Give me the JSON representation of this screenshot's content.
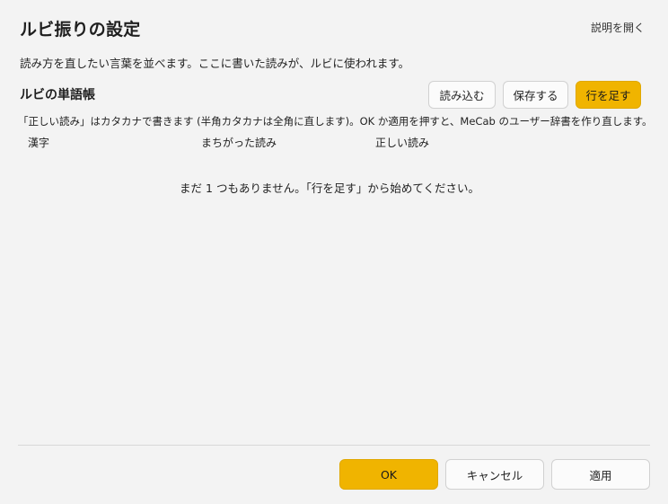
{
  "dialog": {
    "title": "ルビ振りの設定",
    "help_link": "説明を開く",
    "description": "読み方を直したい言葉を並べます。ここに書いた読みが、ルビに使われます。"
  },
  "dictionary": {
    "section_title": "ルビの単語帳",
    "load_label": "読み込む",
    "save_label": "保存する",
    "add_row_label": "行を足す",
    "note": "「正しい読み」はカタカナで書きます (半角カタカナは全角に直します)。OK か適用を押すと、MeCab のユーザー辞書を作り直します。",
    "columns": [
      "漢字",
      "まちがった読み",
      "正しい読み"
    ],
    "empty_message": "まだ 1 つもありません。「行を足す」から始めてください。"
  },
  "footer": {
    "ok_label": "OK",
    "cancel_label": "キャンセル",
    "apply_label": "適用"
  },
  "colors": {
    "accent": "#f0b400",
    "background": "#f3f3f3"
  }
}
